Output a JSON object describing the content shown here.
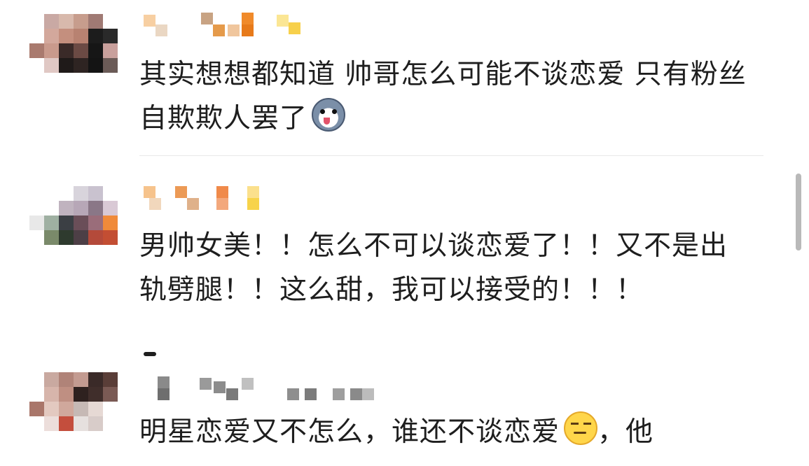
{
  "comments": [
    {
      "text": "其实想想都知道 帅哥怎么可能不谈恋爱 只有粉丝自欺欺人罢了",
      "emoji": "husky-emoji"
    },
    {
      "text": "男帅女美！！怎么不可以谈恋爱了！！又不是出轨劈腿！！这么甜，我可以接受的！！！",
      "emoji": ""
    },
    {
      "text": "明星恋爱又不怎么，谁还不谈恋爱",
      "emoji": "smirk-emoji",
      "text_after": "，他"
    }
  ],
  "colors": {
    "text": "#1e1e1e",
    "divider": "#e8e8e8",
    "scrollbar": "#b9b9b9"
  }
}
